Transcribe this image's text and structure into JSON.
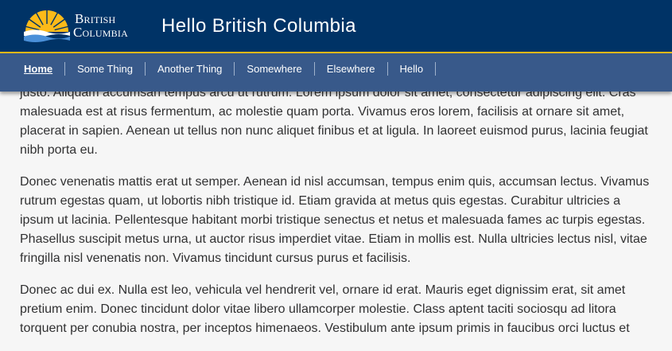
{
  "header": {
    "logo_line1": "British",
    "logo_line2": "Columbia",
    "title": "Hello British Columbia"
  },
  "nav": {
    "items": [
      {
        "label": "Home",
        "active": true
      },
      {
        "label": "Some Thing"
      },
      {
        "label": "Another Thing"
      },
      {
        "label": "Somewhere"
      },
      {
        "label": "Elsewhere"
      },
      {
        "label": "Hello"
      }
    ]
  },
  "content": {
    "paragraphs": [
      "justo. Aliquam accumsan tempus arcu ut rutrum. Lorem ipsum dolor sit amet, consectetur adipiscing elit. Cras malesuada est at risus fermentum, ac molestie quam porta. Vivamus eros lorem, facilisis at ornare sit amet, placerat in sapien. Aenean ut tellus non nunc aliquet finibus et at ligula. In laoreet euismod purus, lacinia feugiat nibh porta eu.",
      "Donec venenatis mattis erat ut semper. Aenean id nisl accumsan, tempus enim quis, accumsan lectus. Vivamus rutrum egestas quam, ut lobortis nibh tristique id. Etiam gravida at metus quis egestas. Curabitur ultricies a ipsum ut lacinia. Pellentesque habitant morbi tristique senectus et netus et malesuada fames ac turpis egestas. Phasellus suscipit metus urna, ut auctor risus imperdiet vitae. Etiam in mollis est. Nulla ultricies lectus nisl, vitae fringilla nisl venenatis non. Vivamus tincidunt cursus purus et facilisis.",
      "Donec ac dui ex. Nulla est leo, vehicula vel hendrerit vel, ornare id erat. Mauris eget dignissim erat, sit amet pretium enim. Donec tincidunt dolor vitae libero ullamcorper molestie. Class aptent taciti sociosqu ad litora torquent per conubia nostra, per inceptos himenaeos. Vestibulum ante ipsum primis in faucibus orci luctus et"
    ]
  },
  "colors": {
    "header_bg": "#003366",
    "accent": "#fcba19",
    "nav_bg": "#38598a",
    "text": "#313132"
  }
}
